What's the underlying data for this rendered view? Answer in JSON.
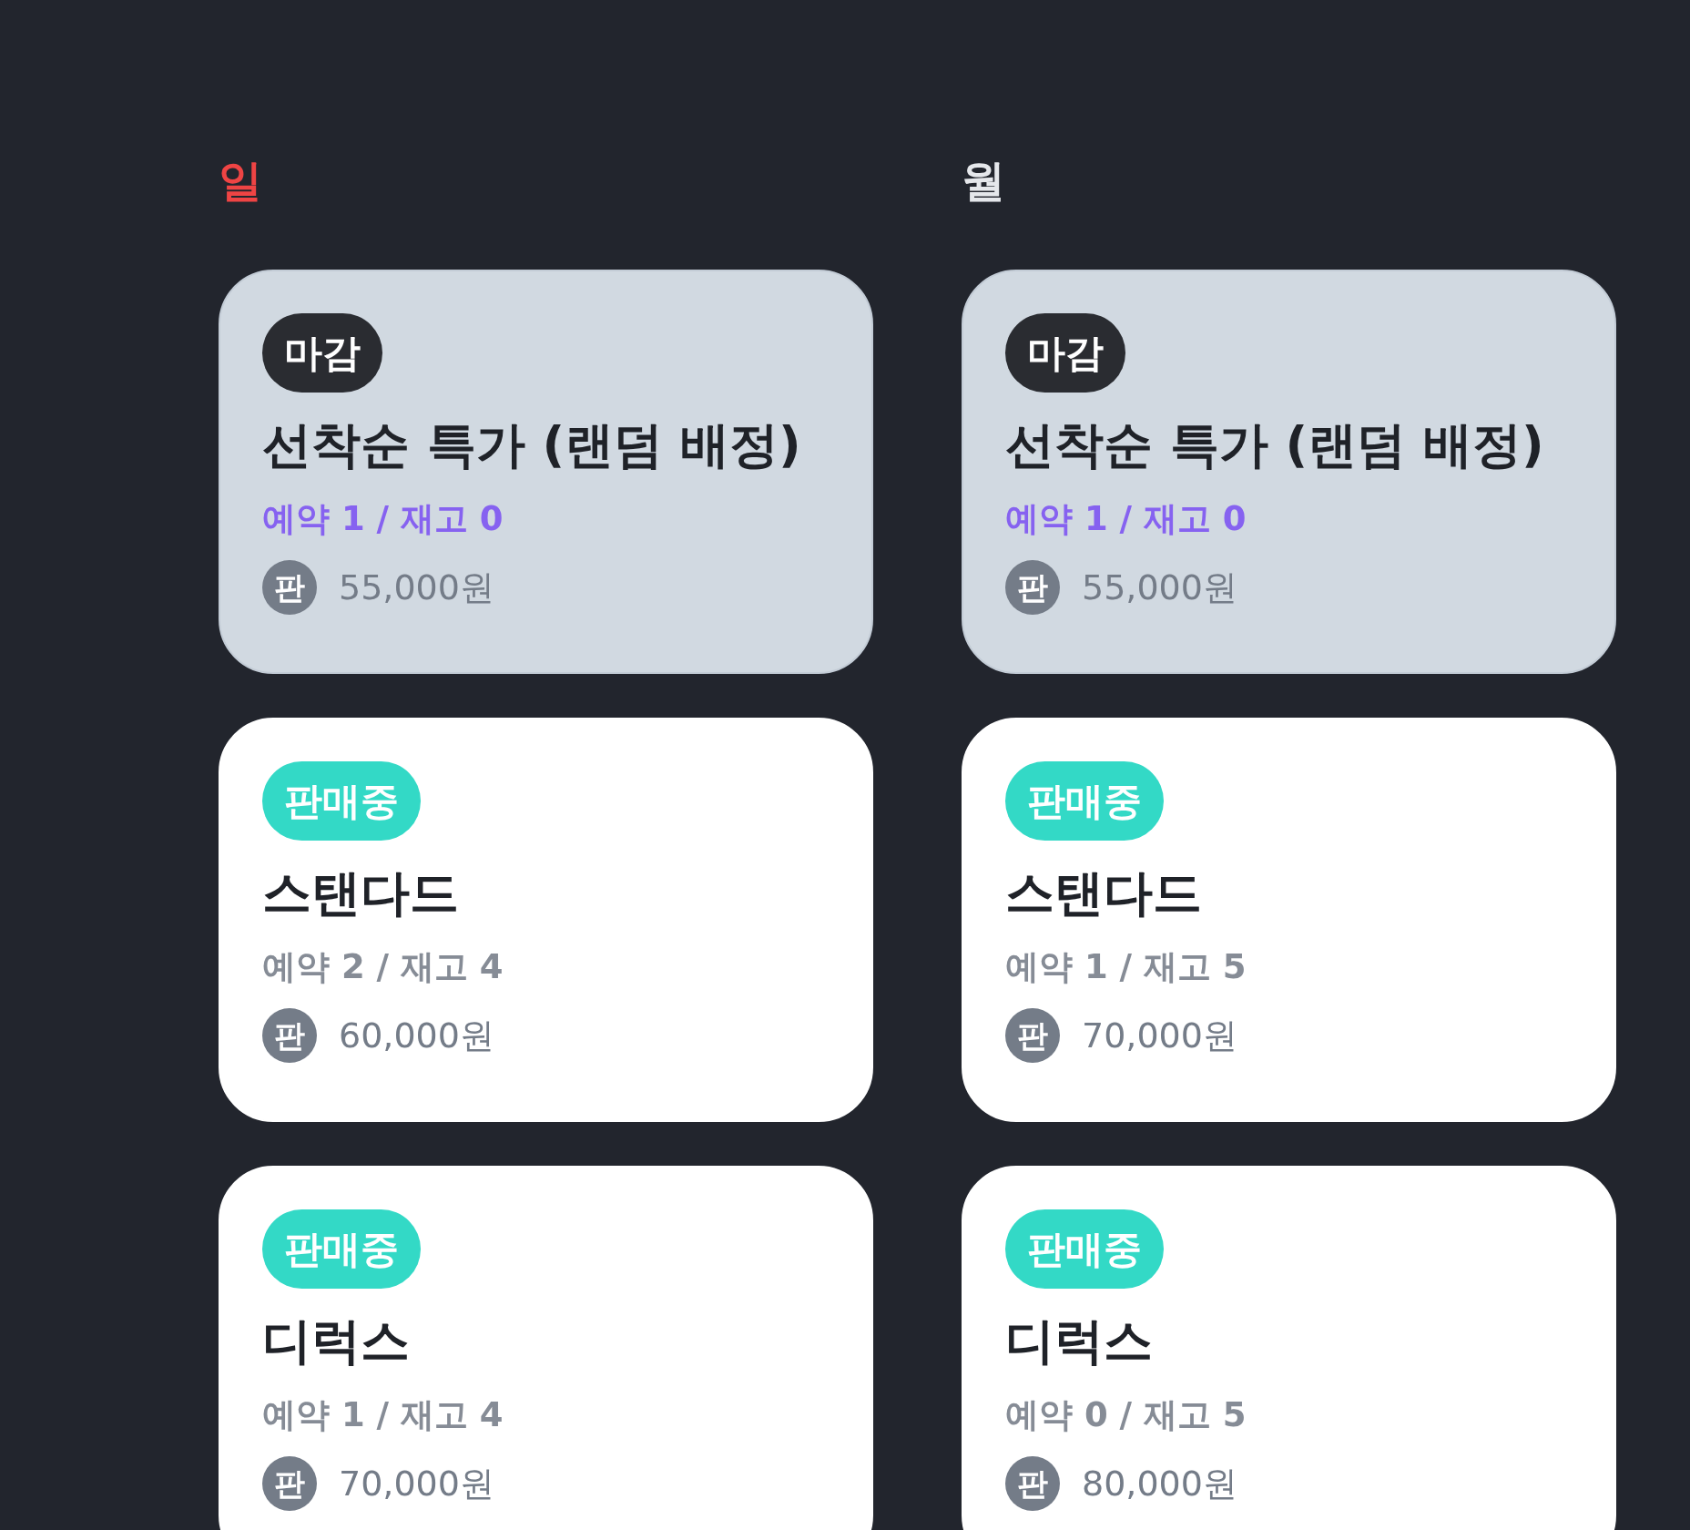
{
  "days": [
    {
      "label": "일",
      "color": "#ef4444",
      "tickets": [
        {
          "badge": "마감",
          "closed": true,
          "title": "선착순 특가 (랜덤 배정)",
          "stock": "예약 1 / 재고 0",
          "price_mark": "판",
          "price": "55,000원"
        },
        {
          "badge": "판매중",
          "closed": false,
          "title": "스탠다드",
          "stock": "예약 2 / 재고 4",
          "price_mark": "판",
          "price": "60,000원"
        },
        {
          "badge": "판매중",
          "closed": false,
          "title": "디럭스",
          "stock": "예약 1 / 재고 4",
          "price_mark": "판",
          "price": "70,000원"
        }
      ]
    },
    {
      "label": "월",
      "color": "#e5e7eb",
      "tickets": [
        {
          "badge": "마감",
          "closed": true,
          "title": "선착순 특가 (랜덤 배정)",
          "stock": "예약 1 / 재고 0",
          "price_mark": "판",
          "price": "55,000원"
        },
        {
          "badge": "판매중",
          "closed": false,
          "title": "스탠다드",
          "stock": "예약 1 / 재고 5",
          "price_mark": "판",
          "price": "70,000원"
        },
        {
          "badge": "판매중",
          "closed": false,
          "title": "디럭스",
          "stock": "예약 0 / 재고 5",
          "price_mark": "판",
          "price": "80,000원"
        }
      ]
    }
  ]
}
